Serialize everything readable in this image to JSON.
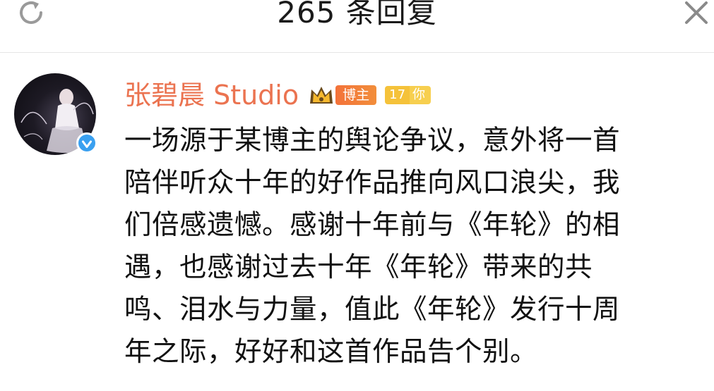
{
  "header": {
    "title": "265 条回复",
    "refresh_icon": "refresh-icon",
    "close_icon": "close-icon"
  },
  "comment": {
    "author": "张碧晨 Studio",
    "badges": {
      "crown_icon": "crown-icon",
      "blogger_label": "博主",
      "level": "17",
      "level_you": "你"
    },
    "verified_icon": "verified-v-icon",
    "body_lines": [
      "一场源于某博主的舆论争议，意外将一首",
      "陪伴听众十年的好作品推向风口浪尖，我",
      "们倍感遗憾。感谢十年前与《年轮》的相",
      "遇，也感谢过去十年《年轮》带来的共",
      "鸣、泪水与力量，值此《年轮》发行十周",
      "年之际，好好和这首作品告个别。"
    ]
  },
  "colors": {
    "username": "#eb7350",
    "verified": "#3aa0f0",
    "blogger_badge": "#f3723a",
    "level_badge": "#f5c23a"
  }
}
